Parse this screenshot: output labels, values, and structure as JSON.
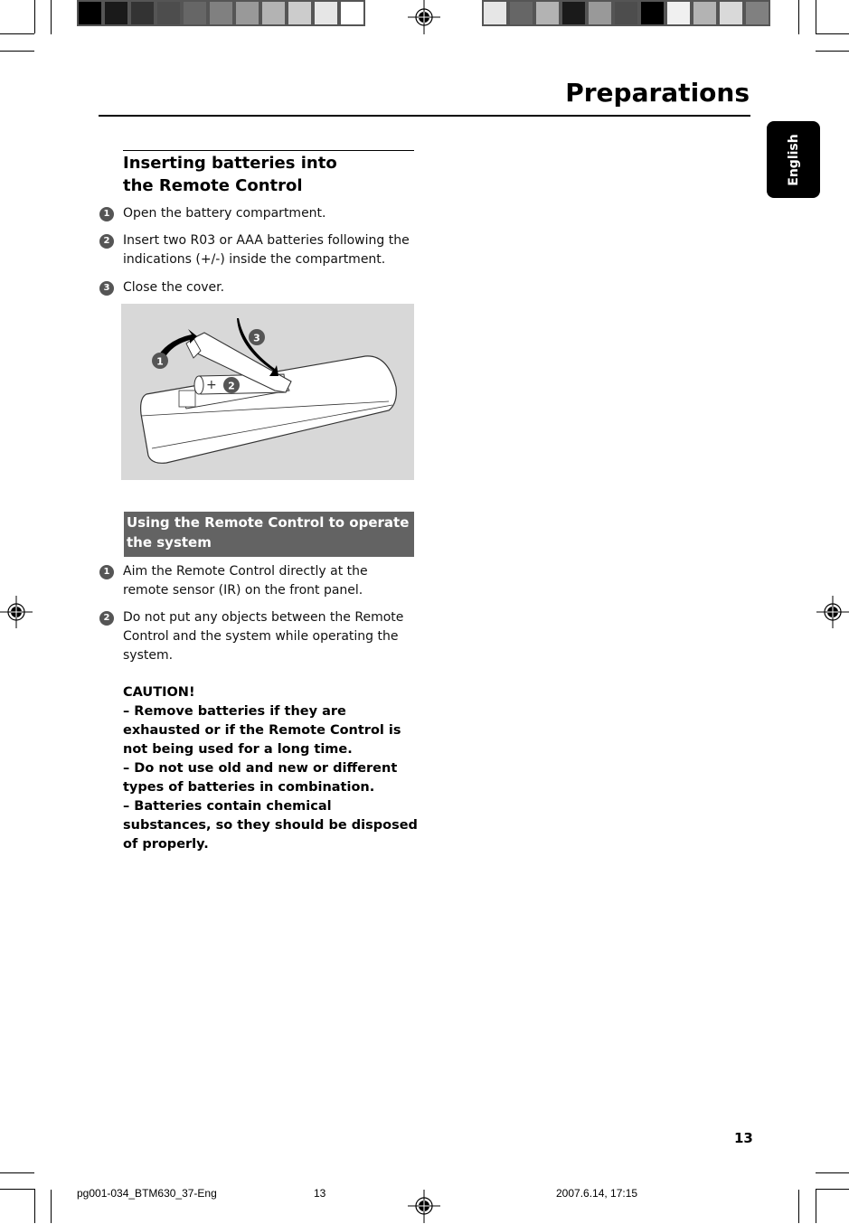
{
  "header": {
    "title": "Preparations",
    "language_tab": "English"
  },
  "color_bar_left": [
    "#000000",
    "#1a1a1a",
    "#333333",
    "#4d4d4d",
    "#666666",
    "#808080",
    "#999999",
    "#b3b3b3",
    "#cccccc",
    "#e6e6e6",
    "#ffffff"
  ],
  "color_bar_right": [
    "#e6e6e6",
    "#666666",
    "#b3b3b3",
    "#1a1a1a",
    "#999999",
    "#4d4d4d",
    "#000000",
    "#f0f0f0",
    "#b3b3b3",
    "#d9d9d9",
    "#808080"
  ],
  "section1": {
    "heading_line1": "Inserting batteries into",
    "heading_line2": "the Remote Control",
    "steps": [
      {
        "num": "1",
        "text": "Open the battery compartment."
      },
      {
        "num": "2",
        "text": "Insert two R03 or AAA batteries following the indications (+/-) inside the compartment."
      },
      {
        "num": "3",
        "text": "Close the cover."
      }
    ],
    "figure": {
      "callouts": [
        "1",
        "2",
        "3"
      ],
      "plus_sign": "+"
    }
  },
  "section2": {
    "heading": "Using the Remote Control to operate the system",
    "steps": [
      {
        "num": "1",
        "text": "Aim the Remote Control directly at the remote sensor (IR) on the front panel."
      },
      {
        "num": "2",
        "text": "Do not put any objects between the Remote Control and the system while operating the system."
      }
    ]
  },
  "caution": {
    "title": "CAUTION!",
    "items": [
      "–  Remove batteries if they are exhausted or if the Remote Control is not being used for a long time.",
      "–  Do not use old and new or different types of batteries in combination.",
      "–  Batteries contain chemical substances, so they should be disposed of properly."
    ]
  },
  "footer": {
    "page_number": "13",
    "slug_file": "pg001-034_BTM630_37-Eng",
    "slug_page": "13",
    "slug_date": "2007.6.14, 17:15"
  }
}
